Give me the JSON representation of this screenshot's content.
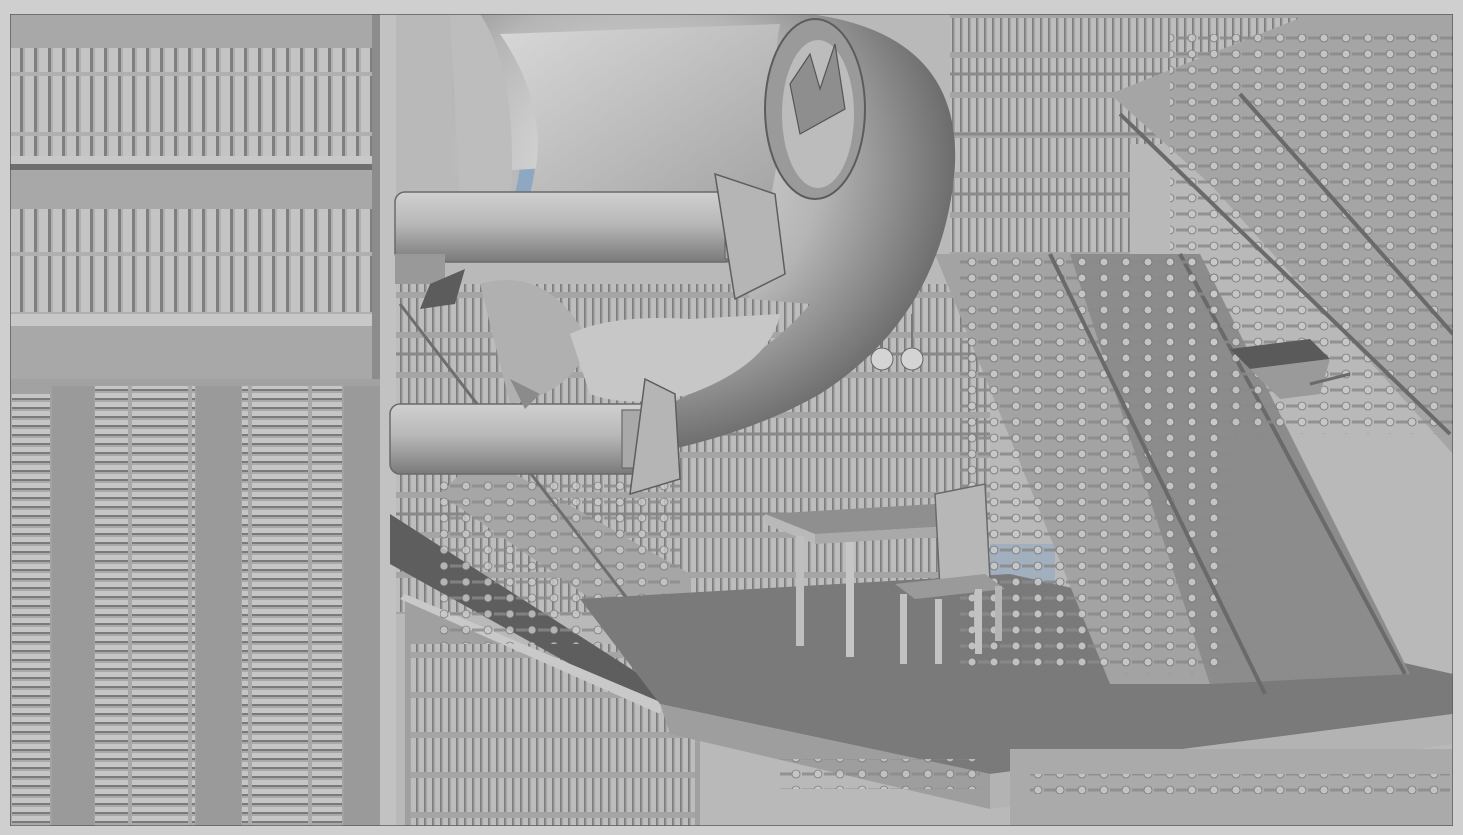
{
  "colors": {
    "frame_border": "#cfcfcf",
    "sky": "#8ea7c2",
    "background_wall": "#b9b9b9",
    "shelf_panel": "#a6a6a6",
    "book_light": "#c3c3c3",
    "book_dark": "#7d7d7d",
    "stair_face": "#9c9c9c",
    "floor_dark": "#747474",
    "floor_light": "#8c8c8c",
    "sphere_light": "#d9d9d9",
    "sphere_mid": "#aaaaaa",
    "sphere_dark": "#5a5a5a",
    "edge": "#4a4a4a"
  },
  "scene": {
    "description_free": true,
    "objects": [
      "left-bookshelf",
      "lower-left-bookshelf",
      "center-bookshelf",
      "spherical-sculpture",
      "upper-pillar",
      "lower-pillar",
      "reading-table",
      "wooden-chair",
      "right-staircase",
      "upper-right-staircase",
      "center-staircase",
      "floor-platform",
      "ceiling-lamps",
      "hanging-box"
    ]
  }
}
